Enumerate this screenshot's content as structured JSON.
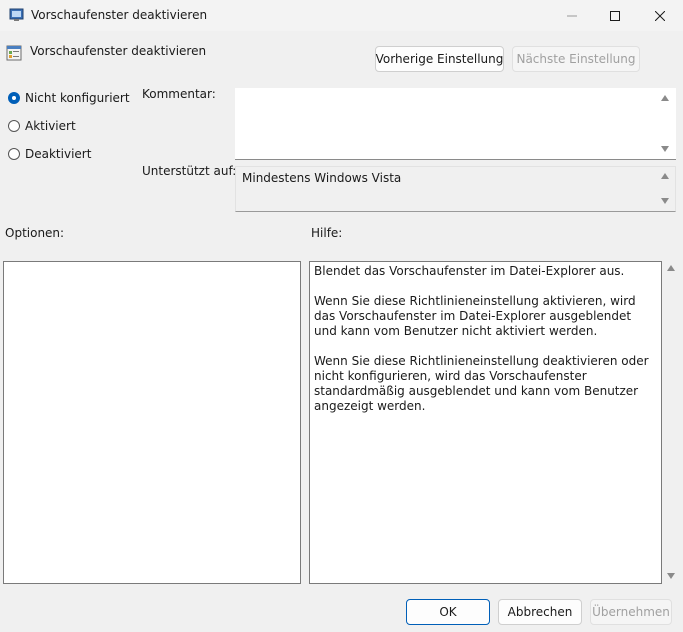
{
  "window": {
    "title": "Vorschaufenster deaktivieren"
  },
  "header": {
    "policy_title": "Vorschaufenster deaktivieren",
    "prev_label": "Vorherige Einstellung",
    "next_label": "Nächste Einstellung"
  },
  "state": {
    "options": [
      {
        "label": "Nicht konfiguriert",
        "checked": true
      },
      {
        "label": "Aktiviert",
        "checked": false
      },
      {
        "label": "Deaktiviert",
        "checked": false
      }
    ]
  },
  "labels": {
    "comment": "Kommentar:",
    "supported": "Unterstützt auf:",
    "options": "Optionen:",
    "help": "Hilfe:"
  },
  "comment_value": "",
  "supported_value": "Mindestens Windows Vista",
  "help": {
    "paragraphs": [
      "Blendet das Vorschaufenster im Datei-Explorer aus.",
      "Wenn Sie diese Richtlinieneinstellung aktivieren, wird das Vorschaufenster im Datei-Explorer ausgeblendet und kann vom Benutzer nicht aktiviert werden.",
      "Wenn Sie diese Richtlinieneinstellung deaktivieren oder nicht konfigurieren, wird das Vorschaufenster standardmäßig ausgeblendet und kann vom Benutzer angezeigt werden."
    ]
  },
  "footer": {
    "ok_label": "OK",
    "cancel_label": "Abbrechen",
    "apply_label": "Übernehmen"
  },
  "colors": {
    "accent": "#005fb8",
    "background": "#f0f0f0"
  },
  "icons": {
    "title": "group-policy-window-icon",
    "policy": "policy-setting-icon",
    "minimize": "minimize-icon",
    "maximize": "maximize-icon",
    "close": "close-icon",
    "scroll_up": "chevron-up-icon",
    "scroll_down": "chevron-down-icon"
  }
}
